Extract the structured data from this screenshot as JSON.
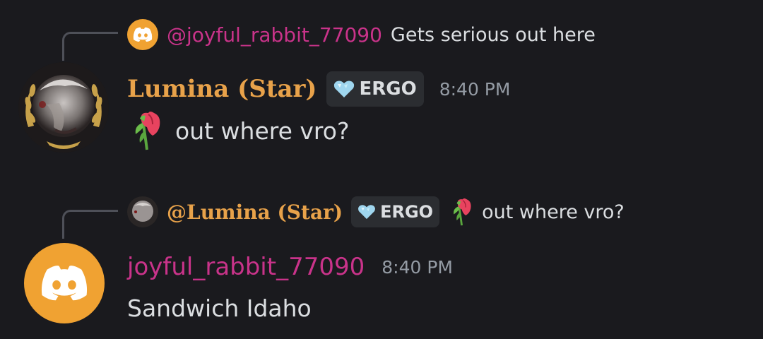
{
  "messages": [
    {
      "reply": {
        "author": "@joyful_rabbit_77090",
        "text": "Gets serious out here",
        "avatar_icon": "discord-logo-icon"
      },
      "author": "Lumina (Star)",
      "author_color": "#e8a24a",
      "tag": {
        "icon": "heart-gem-icon",
        "label": "ERGO"
      },
      "time": "8:40 PM",
      "emoji": "wilted-rose-icon",
      "text": "out where vro?"
    },
    {
      "reply": {
        "author": "@Lumina (Star)",
        "tag": {
          "icon": "heart-gem-icon",
          "label": "ERGO"
        },
        "emoji": "wilted-rose-icon",
        "text": "out where vro?"
      },
      "author": "joyful_rabbit_77090",
      "author_color": "#c9338a",
      "avatar_icon": "discord-logo-icon",
      "time": "8:40 PM",
      "text": "Sandwich Idaho"
    }
  ],
  "colors": {
    "background": "#1a1a1e",
    "discord_orange": "#f0a232",
    "timestamp": "#949ba4",
    "tag_bg": "#2b2d31"
  }
}
